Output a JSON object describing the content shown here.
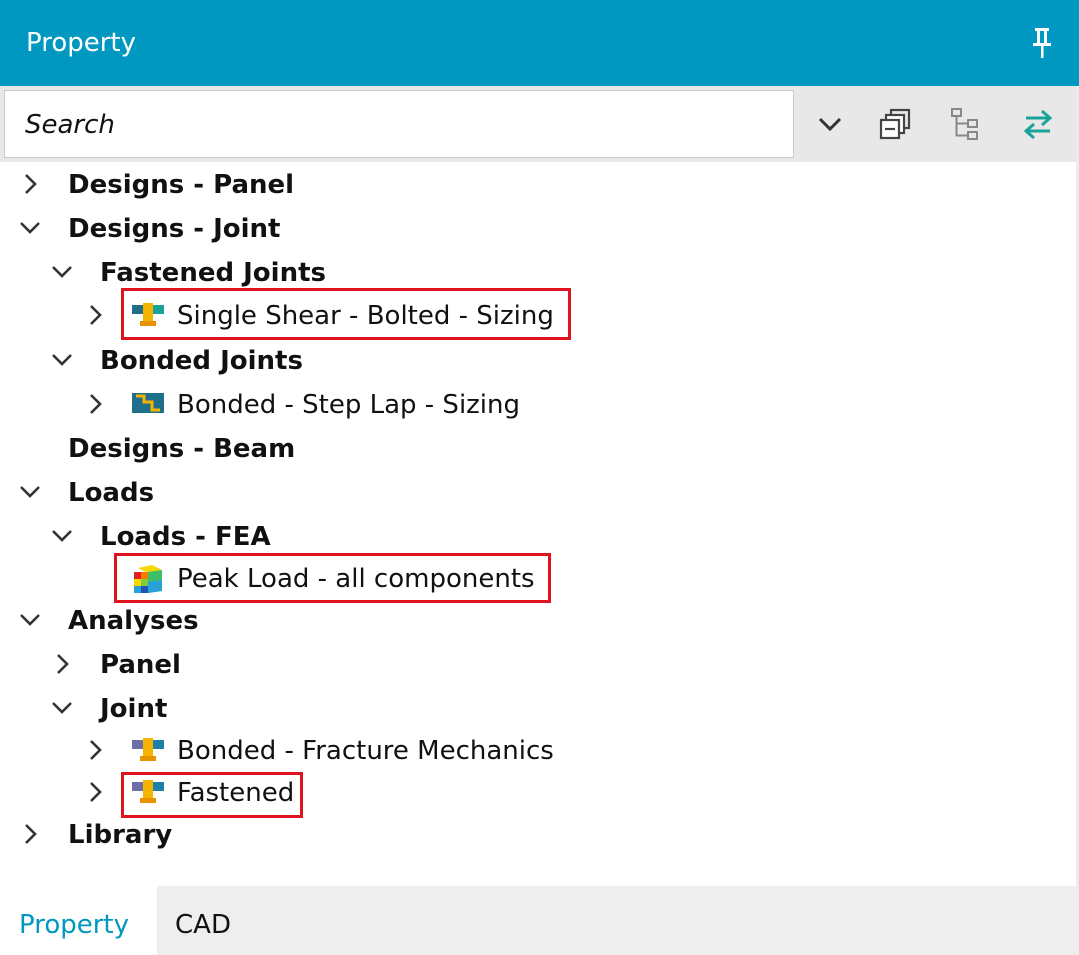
{
  "panel": {
    "title": "Property",
    "pin_icon": "pin-icon"
  },
  "search": {
    "placeholder": "Search",
    "value": "Search"
  },
  "toolbar": {
    "dropdown_icon": "chevron-down-icon",
    "collapse_icon": "collapse-all-icon",
    "tree_icon": "tree-view-icon",
    "sync_icon": "sync-arrows-icon"
  },
  "tree": {
    "designs_panel": "Designs - Panel",
    "designs_joint": "Designs - Joint",
    "fastened_joints": "Fastened Joints",
    "single_shear": "Single Shear - Bolted - Sizing",
    "bonded_joints": "Bonded Joints",
    "bonded_step_lap": "Bonded - Step Lap - Sizing",
    "designs_beam": "Designs - Beam",
    "loads": "Loads",
    "loads_fea": "Loads - FEA",
    "peak_load": "Peak Load - all components",
    "analyses": "Analyses",
    "panel": "Panel",
    "joint": "Joint",
    "bonded_fracture": "Bonded - Fracture Mechanics",
    "fastened": "Fastened",
    "library": "Library"
  },
  "tabs": [
    {
      "label": "Property",
      "active": true
    },
    {
      "label": "CAD",
      "active": false
    }
  ],
  "colors": {
    "accent": "#0098c0",
    "highlight": "#e0141e",
    "teal": "#1aa39a"
  }
}
